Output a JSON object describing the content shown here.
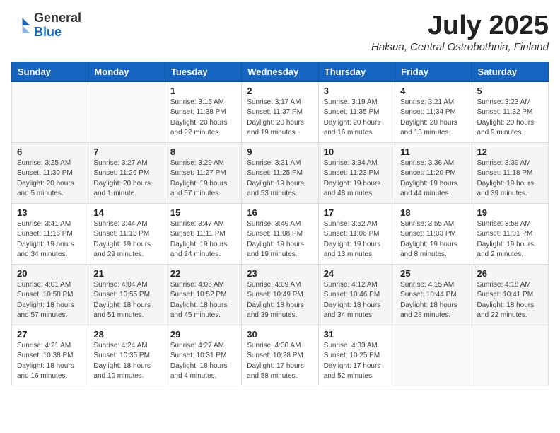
{
  "header": {
    "logo_general": "General",
    "logo_blue": "Blue",
    "main_title": "July 2025",
    "subtitle": "Halsua, Central Ostrobothnia, Finland"
  },
  "days_of_week": [
    "Sunday",
    "Monday",
    "Tuesday",
    "Wednesday",
    "Thursday",
    "Friday",
    "Saturday"
  ],
  "weeks": [
    [
      {
        "day": "",
        "detail": ""
      },
      {
        "day": "",
        "detail": ""
      },
      {
        "day": "1",
        "detail": "Sunrise: 3:15 AM\nSunset: 11:38 PM\nDaylight: 20 hours\nand 22 minutes."
      },
      {
        "day": "2",
        "detail": "Sunrise: 3:17 AM\nSunset: 11:37 PM\nDaylight: 20 hours\nand 19 minutes."
      },
      {
        "day": "3",
        "detail": "Sunrise: 3:19 AM\nSunset: 11:35 PM\nDaylight: 20 hours\nand 16 minutes."
      },
      {
        "day": "4",
        "detail": "Sunrise: 3:21 AM\nSunset: 11:34 PM\nDaylight: 20 hours\nand 13 minutes."
      },
      {
        "day": "5",
        "detail": "Sunrise: 3:23 AM\nSunset: 11:32 PM\nDaylight: 20 hours\nand 9 minutes."
      }
    ],
    [
      {
        "day": "6",
        "detail": "Sunrise: 3:25 AM\nSunset: 11:30 PM\nDaylight: 20 hours\nand 5 minutes."
      },
      {
        "day": "7",
        "detail": "Sunrise: 3:27 AM\nSunset: 11:29 PM\nDaylight: 20 hours\nand 1 minute."
      },
      {
        "day": "8",
        "detail": "Sunrise: 3:29 AM\nSunset: 11:27 PM\nDaylight: 19 hours\nand 57 minutes."
      },
      {
        "day": "9",
        "detail": "Sunrise: 3:31 AM\nSunset: 11:25 PM\nDaylight: 19 hours\nand 53 minutes."
      },
      {
        "day": "10",
        "detail": "Sunrise: 3:34 AM\nSunset: 11:23 PM\nDaylight: 19 hours\nand 48 minutes."
      },
      {
        "day": "11",
        "detail": "Sunrise: 3:36 AM\nSunset: 11:20 PM\nDaylight: 19 hours\nand 44 minutes."
      },
      {
        "day": "12",
        "detail": "Sunrise: 3:39 AM\nSunset: 11:18 PM\nDaylight: 19 hours\nand 39 minutes."
      }
    ],
    [
      {
        "day": "13",
        "detail": "Sunrise: 3:41 AM\nSunset: 11:16 PM\nDaylight: 19 hours\nand 34 minutes."
      },
      {
        "day": "14",
        "detail": "Sunrise: 3:44 AM\nSunset: 11:13 PM\nDaylight: 19 hours\nand 29 minutes."
      },
      {
        "day": "15",
        "detail": "Sunrise: 3:47 AM\nSunset: 11:11 PM\nDaylight: 19 hours\nand 24 minutes."
      },
      {
        "day": "16",
        "detail": "Sunrise: 3:49 AM\nSunset: 11:08 PM\nDaylight: 19 hours\nand 19 minutes."
      },
      {
        "day": "17",
        "detail": "Sunrise: 3:52 AM\nSunset: 11:06 PM\nDaylight: 19 hours\nand 13 minutes."
      },
      {
        "day": "18",
        "detail": "Sunrise: 3:55 AM\nSunset: 11:03 PM\nDaylight: 19 hours\nand 8 minutes."
      },
      {
        "day": "19",
        "detail": "Sunrise: 3:58 AM\nSunset: 11:01 PM\nDaylight: 19 hours\nand 2 minutes."
      }
    ],
    [
      {
        "day": "20",
        "detail": "Sunrise: 4:01 AM\nSunset: 10:58 PM\nDaylight: 18 hours\nand 57 minutes."
      },
      {
        "day": "21",
        "detail": "Sunrise: 4:04 AM\nSunset: 10:55 PM\nDaylight: 18 hours\nand 51 minutes."
      },
      {
        "day": "22",
        "detail": "Sunrise: 4:06 AM\nSunset: 10:52 PM\nDaylight: 18 hours\nand 45 minutes."
      },
      {
        "day": "23",
        "detail": "Sunrise: 4:09 AM\nSunset: 10:49 PM\nDaylight: 18 hours\nand 39 minutes."
      },
      {
        "day": "24",
        "detail": "Sunrise: 4:12 AM\nSunset: 10:46 PM\nDaylight: 18 hours\nand 34 minutes."
      },
      {
        "day": "25",
        "detail": "Sunrise: 4:15 AM\nSunset: 10:44 PM\nDaylight: 18 hours\nand 28 minutes."
      },
      {
        "day": "26",
        "detail": "Sunrise: 4:18 AM\nSunset: 10:41 PM\nDaylight: 18 hours\nand 22 minutes."
      }
    ],
    [
      {
        "day": "27",
        "detail": "Sunrise: 4:21 AM\nSunset: 10:38 PM\nDaylight: 18 hours\nand 16 minutes."
      },
      {
        "day": "28",
        "detail": "Sunrise: 4:24 AM\nSunset: 10:35 PM\nDaylight: 18 hours\nand 10 minutes."
      },
      {
        "day": "29",
        "detail": "Sunrise: 4:27 AM\nSunset: 10:31 PM\nDaylight: 18 hours\nand 4 minutes."
      },
      {
        "day": "30",
        "detail": "Sunrise: 4:30 AM\nSunset: 10:28 PM\nDaylight: 17 hours\nand 58 minutes."
      },
      {
        "day": "31",
        "detail": "Sunrise: 4:33 AM\nSunset: 10:25 PM\nDaylight: 17 hours\nand 52 minutes."
      },
      {
        "day": "",
        "detail": ""
      },
      {
        "day": "",
        "detail": ""
      }
    ]
  ]
}
